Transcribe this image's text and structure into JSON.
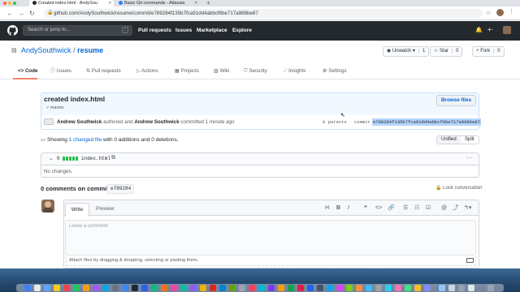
{
  "browser": {
    "tabs": [
      {
        "label": "Created index.html · AndySou",
        "close": "×"
      },
      {
        "label": "Basic Git commands - Atlassia",
        "close": "×"
      }
    ],
    "new_tab": "+",
    "url": "github.com/AndySouthwick/resume/commit/e789284f135b7fca91dd4abbcf6be717a986be87"
  },
  "header": {
    "search_placeholder": "Search or jump to...",
    "search_key": "/",
    "nav": [
      "Pull requests",
      "Issues",
      "Marketplace",
      "Explore"
    ],
    "plus": "+·",
    "bell": "🔔"
  },
  "repo": {
    "owner": "AndySouthwick",
    "sep": " / ",
    "name": "resume",
    "unwatch_label": "Unwatch ▾",
    "unwatch_count": "1",
    "star_label": "Star",
    "star_count": "0",
    "fork_label": "Fork",
    "fork_count": "0"
  },
  "tabs": [
    "Code",
    "Issues",
    "Pull requests",
    "Actions",
    "Projects",
    "Wiki",
    "Security",
    "Insights",
    "Settings"
  ],
  "commit": {
    "title": "created index.html",
    "branch": "master",
    "browse_label": "Browse files",
    "author": "Andrew Southwick",
    "authored": "authored and",
    "committer": "Andrew Southwick",
    "committed": "committed 1 minute ago",
    "parents": "0 parents",
    "commit_label": "commit",
    "sha": "e789284f135b7fca91dd4abbcf6be717a986be87"
  },
  "diffstat": {
    "prefix": "Showing ",
    "changed": "1 changed file",
    "suffix": " with 0 additions and 0 deletions.",
    "unified": "Unified",
    "split": "Split"
  },
  "file": {
    "count": "0",
    "name": "index.html",
    "no_changes": "No changes.",
    "more": "···"
  },
  "comments": {
    "title": "0 comments on commit",
    "sha_short": "e789284",
    "lock": "Lock conversation",
    "write_tab": "Write",
    "preview_tab": "Preview",
    "toolbar": [
      "H",
      "B",
      "I",
      "❝",
      "<>",
      "🔗",
      "☰",
      "☷",
      "☑",
      "@",
      "⤴",
      "↰▾"
    ],
    "placeholder": "Leave a comment",
    "attach": "Attach files by dragging & dropping, selecting or pasting them."
  },
  "colors": {
    "header_bg": "#24292e",
    "link": "#0366d6",
    "tab_accent": "#f9826c",
    "sha_highlight": "#b4d5fe",
    "diff_green": "#2cbe4e"
  }
}
